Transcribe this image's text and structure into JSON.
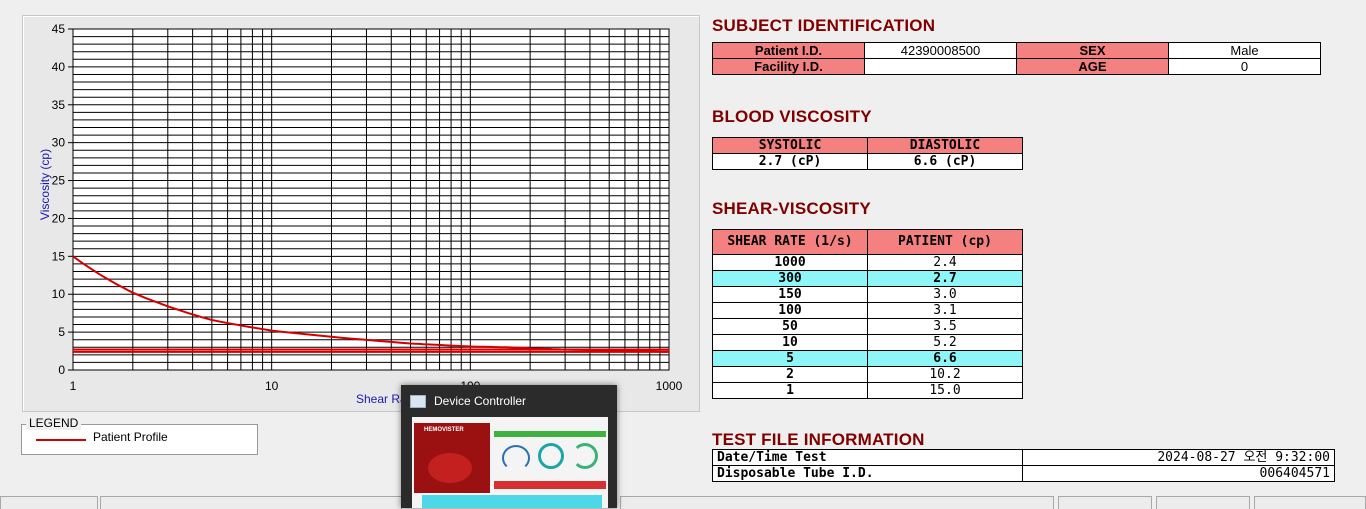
{
  "chart_data": {
    "type": "line",
    "xlabel": "Shear Rate (1/",
    "ylabel": "Viscosity (cp)",
    "xscale": "log",
    "xlim": [
      1,
      1000
    ],
    "ylim": [
      0,
      45
    ],
    "x_ticks": [
      "1",
      "10",
      "100",
      "1000"
    ],
    "y_ticks": [
      "0",
      "5",
      "10",
      "15",
      "20",
      "25",
      "30",
      "35",
      "40",
      "45"
    ],
    "grid": true,
    "series": [
      {
        "name": "Patient Profile",
        "color": "#d40000",
        "x": [
          1,
          2,
          5,
          10,
          50,
          100,
          150,
          300,
          1000
        ],
        "y": [
          15.0,
          10.2,
          6.6,
          5.2,
          3.5,
          3.1,
          3.0,
          2.7,
          2.4
        ]
      }
    ],
    "reference_lines": [
      {
        "y": 2.7,
        "color": "#d40000"
      },
      {
        "y": 2.4,
        "color": "#d40000"
      }
    ]
  },
  "legend": {
    "title": "LEGEND",
    "items": [
      {
        "label": "Patient Profile",
        "color": "#d40000"
      }
    ]
  },
  "subject": {
    "title": "SUBJECT IDENTIFICATION",
    "patient_id_label": "Patient I.D.",
    "patient_id": "42390008500",
    "sex_label": "SEX",
    "sex": "Male",
    "facility_label": "Facility I.D.",
    "facility": "",
    "age_label": "AGE",
    "age": "0"
  },
  "blood": {
    "title": "BLOOD VISCOSITY",
    "systolic_label": "SYSTOLIC",
    "diastolic_label": "DIASTOLIC",
    "systolic": "2.7 (cP)",
    "diastolic": "6.6 (cP)"
  },
  "shear": {
    "title": "SHEAR-VISCOSITY",
    "col1": "SHEAR RATE (1/s)",
    "col2": "PATIENT (cp)",
    "rows": [
      {
        "rate": "1000",
        "val": "2.4",
        "hl": false
      },
      {
        "rate": "300",
        "val": "2.7",
        "hl": true
      },
      {
        "rate": "150",
        "val": "3.0",
        "hl": false
      },
      {
        "rate": "100",
        "val": "3.1",
        "hl": false
      },
      {
        "rate": "50",
        "val": "3.5",
        "hl": false
      },
      {
        "rate": "10",
        "val": "5.2",
        "hl": false
      },
      {
        "rate": "5",
        "val": "6.6",
        "hl": true
      },
      {
        "rate": "2",
        "val": "10.2",
        "hl": false
      },
      {
        "rate": "1",
        "val": "15.0",
        "hl": false
      }
    ]
  },
  "testfile": {
    "title": "TEST FILE INFORMATION",
    "datetime_label": "Date/Time Test",
    "datetime": "2024-08-27   오전 9:32:00",
    "tube_label": "Disposable Tube I.D.",
    "tube": "006404571"
  },
  "popup": {
    "title": "Device Controller",
    "thumb_brand": "HEMOVISTER"
  }
}
